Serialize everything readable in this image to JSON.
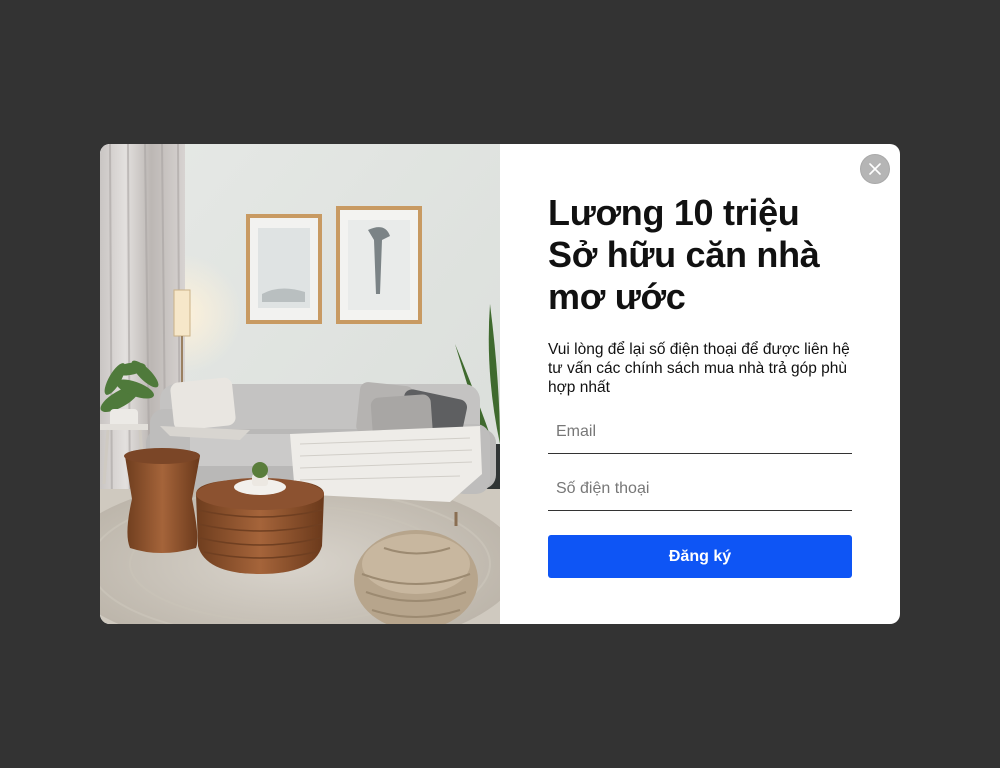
{
  "modal": {
    "image_alt": "living-room-photo",
    "close_icon": "close-icon",
    "headline": "Lương 10 triệu Sở hữu căn nhà mơ ước",
    "subtext": "Vui lòng để lại số điện thoại để được liên hệ tư vấn các chính sách mua nhà trả góp phù hợp nhất",
    "fields": {
      "email_placeholder": "Email",
      "phone_placeholder": "Số điện thoại"
    },
    "submit_label": "Đăng ký"
  },
  "colors": {
    "backdrop": "#333333",
    "accent": "#0e55f5",
    "close_bg": "#b5b5b5"
  }
}
